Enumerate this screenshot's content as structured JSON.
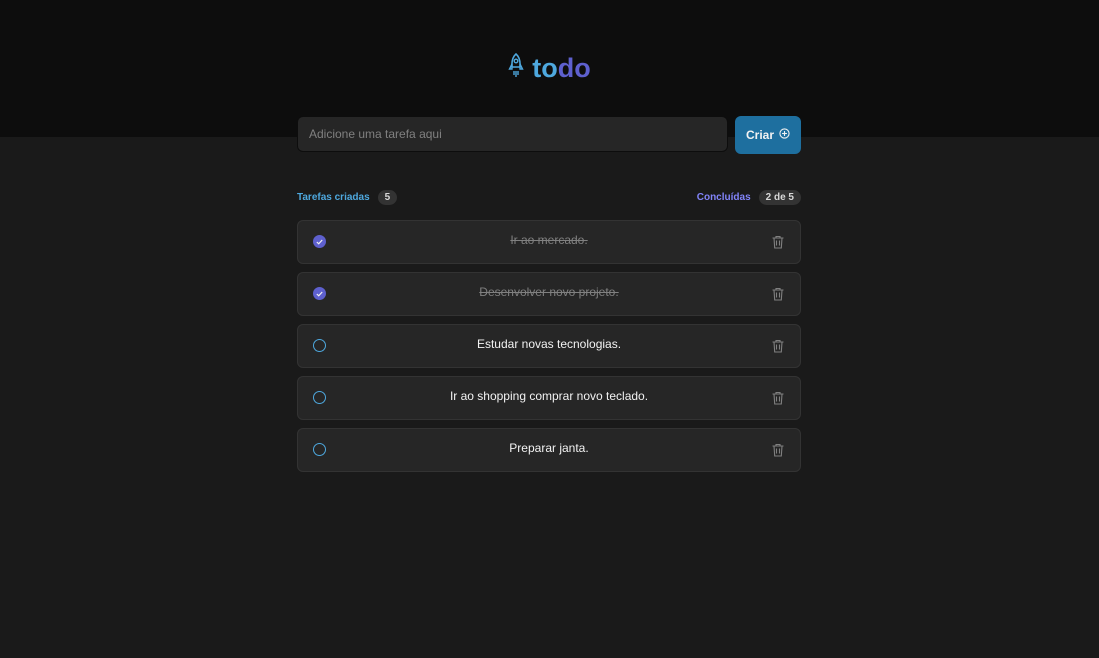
{
  "header": {
    "logo_part1": "to",
    "logo_part2": "do"
  },
  "create": {
    "placeholder": "Adicione uma tarefa aqui",
    "button_label": "Criar"
  },
  "counters": {
    "created_label": "Tarefas criadas",
    "created_count": "5",
    "done_label": "Concluídas",
    "done_count": "2 de 5"
  },
  "tasks": [
    {
      "text": "Ir ao mercado.",
      "completed": true
    },
    {
      "text": "Desenvolver novo projeto.",
      "completed": true
    },
    {
      "text": "Estudar novas tecnologias.",
      "completed": false
    },
    {
      "text": "Ir ao shopping comprar novo teclado.",
      "completed": false
    },
    {
      "text": "Preparar janta.",
      "completed": false
    }
  ],
  "colors": {
    "brand_blue": "#4ea8de",
    "brand_purple": "#5e60ce",
    "button": "#1e6f9f",
    "header_bg": "#0d0d0d",
    "page_bg": "#1a1a1a",
    "card_bg": "#262626"
  },
  "icons": {
    "logo": "rocket-icon",
    "create": "plus-circle-icon",
    "checked": "check-icon",
    "delete": "trash-icon"
  }
}
